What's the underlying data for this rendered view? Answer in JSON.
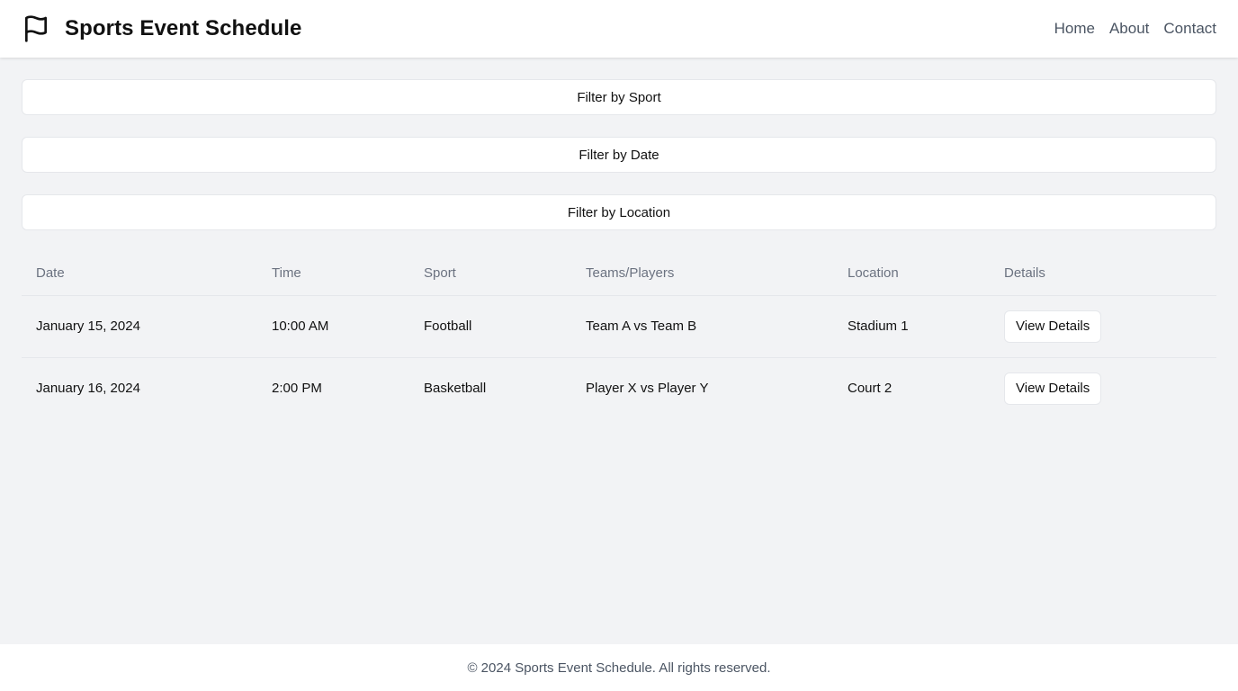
{
  "header": {
    "icon": "flag-icon",
    "title": "Sports Event Schedule",
    "nav": [
      "Home",
      "About",
      "Contact"
    ]
  },
  "filters": [
    "Filter by Sport",
    "Filter by Date",
    "Filter by Location"
  ],
  "table": {
    "columns": [
      "Date",
      "Time",
      "Sport",
      "Teams/Players",
      "Location",
      "Details"
    ],
    "rows": [
      {
        "date": "January 15, 2024",
        "time": "10:00 AM",
        "sport": "Football",
        "teams": "Team A vs Team B",
        "location": "Stadium 1",
        "action": "View Details"
      },
      {
        "date": "January 16, 2024",
        "time": "2:00 PM",
        "sport": "Basketball",
        "teams": "Player X vs Player Y",
        "location": "Court 2",
        "action": "View Details"
      }
    ]
  },
  "footer": {
    "text": "© 2024 Sports Event Schedule. All rights reserved."
  }
}
